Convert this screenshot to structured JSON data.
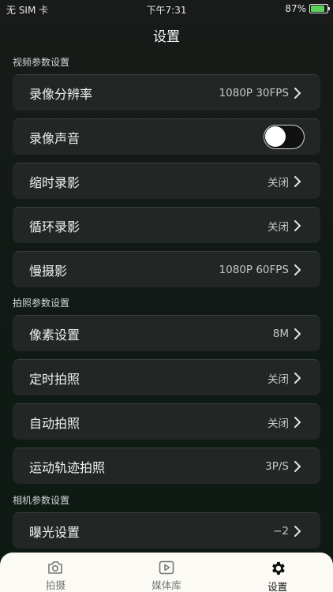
{
  "status": {
    "carrier": "无 SIM 卡",
    "time": "下午7:31",
    "battery": "87%"
  },
  "nav": {
    "title": "设置"
  },
  "sections": [
    {
      "title": "视频参数设置",
      "rows": [
        {
          "label": "录像分辨率",
          "value": "1080P 30FPS"
        },
        {
          "label": "录像声音",
          "toggle": false
        },
        {
          "label": "缩时录影",
          "value": "关闭"
        },
        {
          "label": "循环录影",
          "value": "关闭"
        },
        {
          "label": "慢摄影",
          "value": "1080P 60FPS"
        }
      ]
    },
    {
      "title": "拍照参数设置",
      "rows": [
        {
          "label": "像素设置",
          "value": "8M"
        },
        {
          "label": "定时拍照",
          "value": "关闭"
        },
        {
          "label": "自动拍照",
          "value": "关闭"
        },
        {
          "label": "运动轨迹拍照",
          "value": "3P/S"
        }
      ]
    },
    {
      "title": "相机参数设置",
      "rows": [
        {
          "label": "曝光设置",
          "value": "−2"
        }
      ]
    }
  ],
  "tabs": [
    {
      "label": "拍摄",
      "icon": "camera-icon"
    },
    {
      "label": "媒体库",
      "icon": "media-library-icon"
    },
    {
      "label": "设置",
      "icon": "gear-icon",
      "active": true
    }
  ],
  "colors": {
    "background": "#141a16",
    "row": "#222624",
    "tabbar": "#fbfaf5",
    "battery_fill": "#5ad35a"
  }
}
